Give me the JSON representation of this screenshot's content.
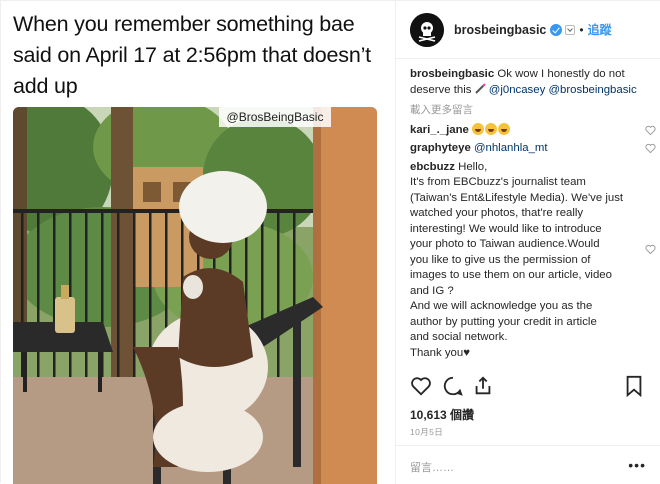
{
  "meme": {
    "caption": "When you remember something bae said on April 17 at 2:56pm that doesn’t add up",
    "watermark": "@BrosBeingBasic"
  },
  "header": {
    "username": "brosbeingbasic",
    "follow_label": "追蹤",
    "dot": "•",
    "avatar_icon": "skull-avatar-icon"
  },
  "comments": {
    "caption_user": "brosbeingbasic",
    "caption_text": " Ok wow I honestly do not deserve this ",
    "caption_mention_1": "@j0ncasey",
    "caption_mention_2": "@brosbeingbasic",
    "load_more": "載入更多留言",
    "items": [
      {
        "user": "kari_._jane",
        "text": ""
      },
      {
        "user": "graphyteye",
        "text": "@nhlanhla_mt"
      },
      {
        "user": "ebcbuzz",
        "text": "Hello,"
      }
    ],
    "ebc_body": [
      "It's from EBCbuzz's journalist team",
      "(Taiwan's Ent&Lifestyle Media). We've just",
      "watched your photos, that're really",
      "interesting! We would like to introduce",
      "your photo to Taiwan audience.Would",
      "you like to give us the permission of",
      "images to use them on our article, video",
      "and IG ?",
      "And we will acknowledge you as the",
      "author by putting your credit in article",
      "and social network.",
      "Thank you♥"
    ]
  },
  "actions": {
    "like_icon": "heart-icon",
    "comment_icon": "comment-icon",
    "share_icon": "share-icon",
    "save_icon": "bookmark-icon"
  },
  "likes": "10,613 個讚",
  "date": "10月5日",
  "add_comment": {
    "placeholder": "留言……",
    "more": "•••"
  },
  "colors": {
    "link": "#3897f0",
    "mention": "#003569",
    "muted": "#999999"
  }
}
